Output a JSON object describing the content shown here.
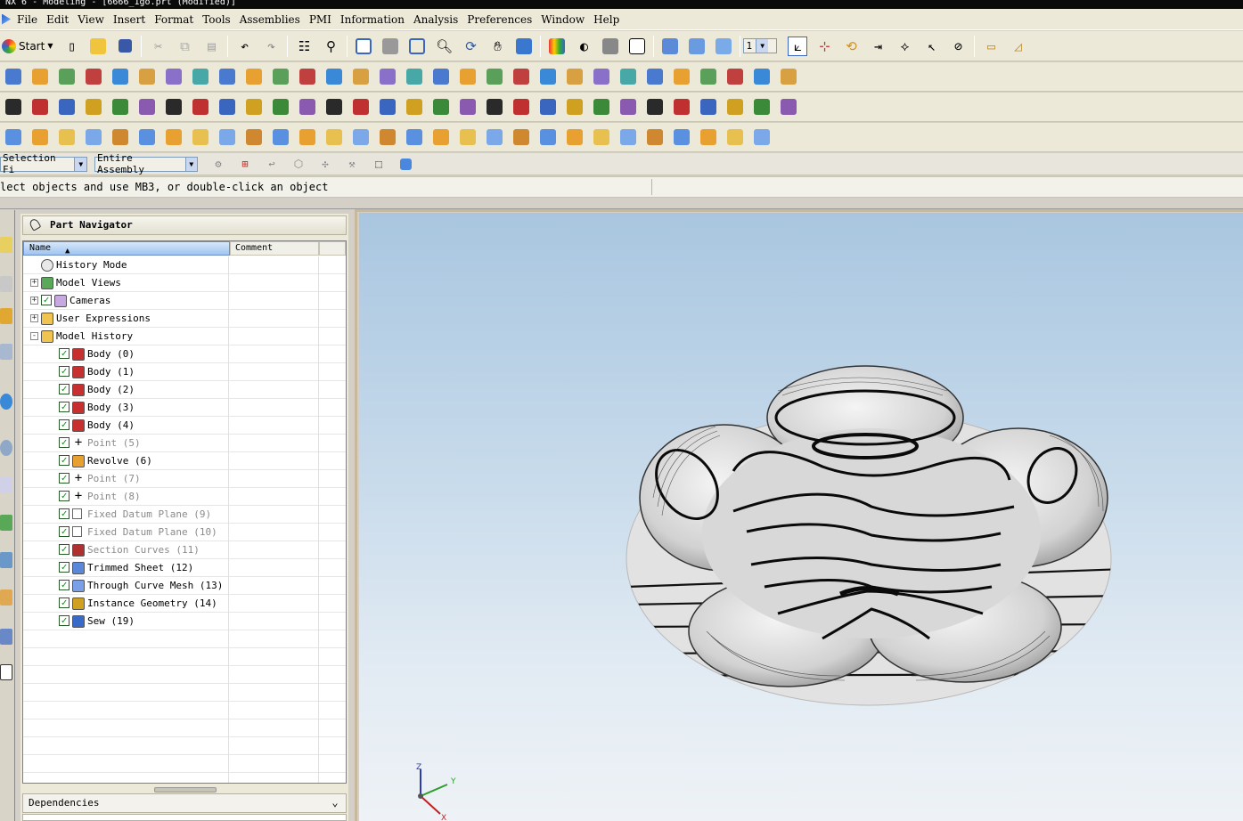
{
  "window": {
    "title": "NX 6 - Modeling - [6666_1go.prt (Modified)]"
  },
  "menubar": [
    "File",
    "Edit",
    "View",
    "Insert",
    "Format",
    "Tools",
    "Assemblies",
    "PMI",
    "Information",
    "Analysis",
    "Preferences",
    "Window",
    "Help"
  ],
  "toolbar": {
    "start_label": "Start",
    "layer_value": "1"
  },
  "selection": {
    "filter_value": "Selection Fi",
    "scope_value": "Entire Assembly"
  },
  "status": {
    "prompt": "lect objects and use MB3, or double-click an object"
  },
  "navigator": {
    "title": "Part Navigator",
    "col_name": "Name",
    "col_comment": "Comment",
    "rows": [
      {
        "label": "History Mode",
        "icon": "clock-icon",
        "level": 0,
        "check": false,
        "expander": "",
        "dim": false
      },
      {
        "label": "Model Views",
        "icon": "views-icon",
        "level": 0,
        "check": false,
        "expander": "+",
        "dim": false
      },
      {
        "label": "Cameras",
        "icon": "camera-icon",
        "level": 0,
        "check": true,
        "expander": "+",
        "dim": false
      },
      {
        "label": "User Expressions",
        "icon": "folder-icon",
        "level": 0,
        "check": false,
        "expander": "+",
        "dim": false
      },
      {
        "label": "Model History",
        "icon": "folder-open-icon",
        "level": 0,
        "check": false,
        "expander": "-",
        "dim": false
      },
      {
        "label": "Body (0)",
        "icon": "body-icon",
        "level": 1,
        "check": true,
        "expander": "",
        "dim": false
      },
      {
        "label": "Body (1)",
        "icon": "body-icon",
        "level": 1,
        "check": true,
        "expander": "",
        "dim": false
      },
      {
        "label": "Body (2)",
        "icon": "body-icon",
        "level": 1,
        "check": true,
        "expander": "",
        "dim": false
      },
      {
        "label": "Body (3)",
        "icon": "body-icon",
        "level": 1,
        "check": true,
        "expander": "",
        "dim": false
      },
      {
        "label": "Body (4)",
        "icon": "body-icon",
        "level": 1,
        "check": true,
        "expander": "",
        "dim": false
      },
      {
        "label": "Point (5)",
        "icon": "point-icon",
        "level": 1,
        "check": true,
        "expander": "",
        "dim": true
      },
      {
        "label": "Revolve (6)",
        "icon": "revolve-icon",
        "level": 1,
        "check": true,
        "expander": "",
        "dim": false
      },
      {
        "label": "Point (7)",
        "icon": "point-icon",
        "level": 1,
        "check": true,
        "expander": "",
        "dim": true
      },
      {
        "label": "Point (8)",
        "icon": "point-icon",
        "level": 1,
        "check": true,
        "expander": "",
        "dim": true
      },
      {
        "label": "Fixed Datum Plane (9)",
        "icon": "datum-plane-icon",
        "level": 1,
        "check": true,
        "expander": "",
        "dim": true
      },
      {
        "label": "Fixed Datum Plane (10)",
        "icon": "datum-plane-icon",
        "level": 1,
        "check": true,
        "expander": "",
        "dim": true
      },
      {
        "label": "Section Curves (11)",
        "icon": "section-curves-icon",
        "level": 1,
        "check": true,
        "expander": "",
        "dim": true
      },
      {
        "label": "Trimmed Sheet (12)",
        "icon": "trimmed-sheet-icon",
        "level": 1,
        "check": true,
        "expander": "",
        "dim": false
      },
      {
        "label": "Through Curve Mesh (13)",
        "icon": "curve-mesh-icon",
        "level": 1,
        "check": true,
        "expander": "",
        "dim": false
      },
      {
        "label": "Instance Geometry (14)",
        "icon": "instance-geometry-icon",
        "level": 1,
        "check": true,
        "expander": "",
        "dim": false
      },
      {
        "label": "Sew (19)",
        "icon": "sew-icon",
        "level": 1,
        "check": true,
        "expander": "",
        "dim": false
      }
    ],
    "dependencies_label": "Dependencies"
  },
  "triad": {
    "z": "Z",
    "y": "Y",
    "x": "X"
  }
}
